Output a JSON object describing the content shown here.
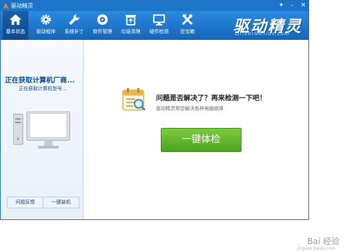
{
  "window": {
    "title": "驱动精灵"
  },
  "toolbar": {
    "items": [
      {
        "label": "基本状态",
        "icon": "home-icon",
        "active": true
      },
      {
        "label": "驱动程序",
        "icon": "gear-icon"
      },
      {
        "label": "系统补丁",
        "icon": "wrench-icon"
      },
      {
        "label": "软件管理",
        "icon": "disc-icon"
      },
      {
        "label": "垃圾清理",
        "icon": "recycle-icon"
      },
      {
        "label": "硬件检测",
        "icon": "monitor-icon"
      },
      {
        "label": "百宝箱",
        "icon": "tools-icon"
      }
    ]
  },
  "logo": {
    "cn": "驱动精灵",
    "en": "DriverGenius.com"
  },
  "sidebar": {
    "status_title": "正在获取计算机厂商...",
    "status_sub": "正在获取计算机型号...",
    "feedback_label": "问题反馈",
    "install_label": "一键装机"
  },
  "main": {
    "question": "问题是否解决了？再来检测一下吧！",
    "subtext": "驱动精灵帮您解决各种电脑故障",
    "check_button": "一键体检"
  },
  "watermark": {
    "text": "Bai 经验",
    "small": "jingyan.baidu.com"
  },
  "colors": {
    "titlebar": "#1b75c9",
    "toolbar": "#1f78d0",
    "sidebar_text": "#0a4d8e",
    "check_button": "#5fb42a"
  }
}
